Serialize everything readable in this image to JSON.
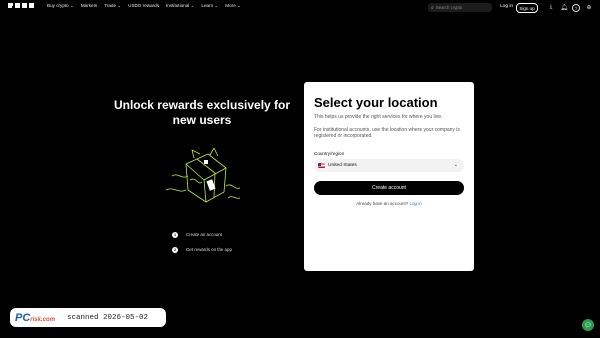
{
  "nav": {
    "items": [
      "Buy crypto ⌄",
      "Markets",
      "Trade ⌄",
      "USDG rewards",
      "Institutional ⌄",
      "Learn ⌄",
      "More ⌄"
    ],
    "search_placeholder": "Search crypto",
    "login": "Log in",
    "signup": "Sign up"
  },
  "promo": {
    "headline": "Unlock rewards exclusively for new users",
    "steps": [
      {
        "num": "1",
        "label": "Create an account"
      },
      {
        "num": "2",
        "label": "Get rewards on the app"
      }
    ]
  },
  "card": {
    "title": "Select your location",
    "subtitle": "This helps us provide the right services for where you live.",
    "institutional_note": "For institutional accounts, use the location where your company is registered or incorporated.",
    "country_label": "Country/region",
    "country_value": "United States",
    "cta": "Create account",
    "already_text": "Already have an account?",
    "login_link": "Log in"
  },
  "watermark": {
    "logo_text": "PC",
    "logo_sub": "risk.com",
    "scan_text": "scanned 2026-05-02"
  },
  "colors": {
    "background": "#000000",
    "card": "#ffffff",
    "accent_green": "#b8f043",
    "link": "#2f6fe0"
  }
}
